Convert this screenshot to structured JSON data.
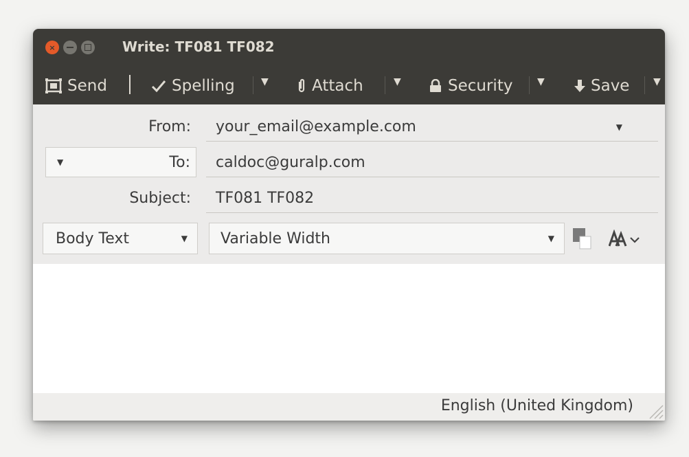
{
  "window": {
    "title": "Write: TF081 TF082"
  },
  "toolbar": {
    "send": "Send",
    "spelling": "Spelling",
    "attach": "Attach",
    "security": "Security",
    "save": "Save"
  },
  "header": {
    "from_label": "From:",
    "from_value": "your_email@example.com",
    "to_label": "To:",
    "to_value": "caldoc@guralp.com",
    "subject_label": "Subject:",
    "subject_value": "TF081 TF082"
  },
  "format": {
    "paragraph_style": "Body Text",
    "font": "Variable Width"
  },
  "status": {
    "language": "English (United Kingdom)"
  },
  "icons": [
    "close-icon",
    "minimize-icon",
    "maximize-icon",
    "send-icon",
    "check-icon",
    "paperclip-icon",
    "lock-icon",
    "download-arrow-icon",
    "text-color-icon",
    "text-size-icon",
    "resize-grip-icon"
  ]
}
